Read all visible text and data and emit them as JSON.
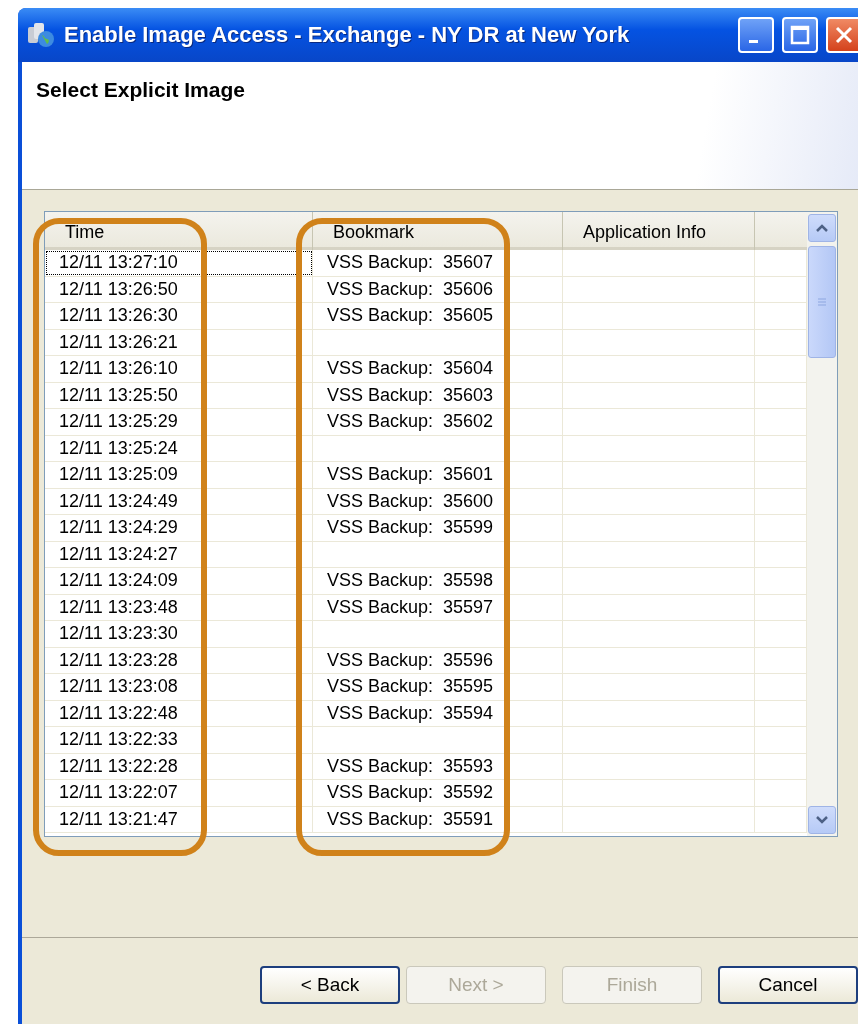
{
  "window": {
    "title": "Enable Image Access - Exchange - NY DR at New York"
  },
  "header": {
    "title": "Select Explicit Image"
  },
  "table": {
    "columns": [
      "Time",
      "Bookmark",
      "Application Info"
    ],
    "rows": [
      {
        "time": "12/11 13:27:10",
        "bookmark": "VSS Backup:  35607",
        "selected": true
      },
      {
        "time": "12/11 13:26:50",
        "bookmark": "VSS Backup:  35606",
        "selected": false
      },
      {
        "time": "12/11 13:26:30",
        "bookmark": "VSS Backup:  35605",
        "selected": false
      },
      {
        "time": "12/11 13:26:21",
        "selected": false
      },
      {
        "time": "12/11 13:26:10",
        "bookmark": "VSS Backup:  35604",
        "selected": false
      },
      {
        "time": "12/11 13:25:50",
        "bookmark": "VSS Backup:  35603",
        "selected": false
      },
      {
        "time": "12/11 13:25:29",
        "bookmark": "VSS Backup:  35602",
        "selected": false
      },
      {
        "time": "12/11 13:25:24",
        "selected": false
      },
      {
        "time": "12/11 13:25:09",
        "bookmark": "VSS Backup:  35601",
        "selected": false
      },
      {
        "time": "12/11 13:24:49",
        "bookmark": "VSS Backup:  35600",
        "selected": false
      },
      {
        "time": "12/11 13:24:29",
        "bookmark": "VSS Backup:  35599",
        "selected": false
      },
      {
        "time": "12/11 13:24:27",
        "selected": false
      },
      {
        "time": "12/11 13:24:09",
        "bookmark": "VSS Backup:  35598",
        "selected": false
      },
      {
        "time": "12/11 13:23:48",
        "bookmark": "VSS Backup:  35597",
        "selected": false
      },
      {
        "time": "12/11 13:23:30",
        "selected": false
      },
      {
        "time": "12/11 13:23:28",
        "bookmark": "VSS Backup:  35596",
        "selected": false
      },
      {
        "time": "12/11 13:23:08",
        "bookmark": "VSS Backup:  35595",
        "selected": false
      },
      {
        "time": "12/11 13:22:48",
        "bookmark": "VSS Backup:  35594",
        "selected": false
      },
      {
        "time": "12/11 13:22:33",
        "selected": false
      },
      {
        "time": "12/11 13:22:28",
        "bookmark": "VSS Backup:  35593",
        "selected": false
      },
      {
        "time": "12/11 13:22:07",
        "bookmark": "VSS Backup:  35592",
        "selected": false
      },
      {
        "time": "12/11 13:21:47",
        "bookmark": "VSS Backup:  35591",
        "selected": false
      }
    ]
  },
  "buttons": [
    {
      "label": "< Back",
      "disabled": false
    },
    {
      "label": "Next >",
      "disabled": true
    },
    {
      "label": "Finish",
      "disabled": true
    },
    {
      "label": "Cancel",
      "disabled": false
    }
  ]
}
